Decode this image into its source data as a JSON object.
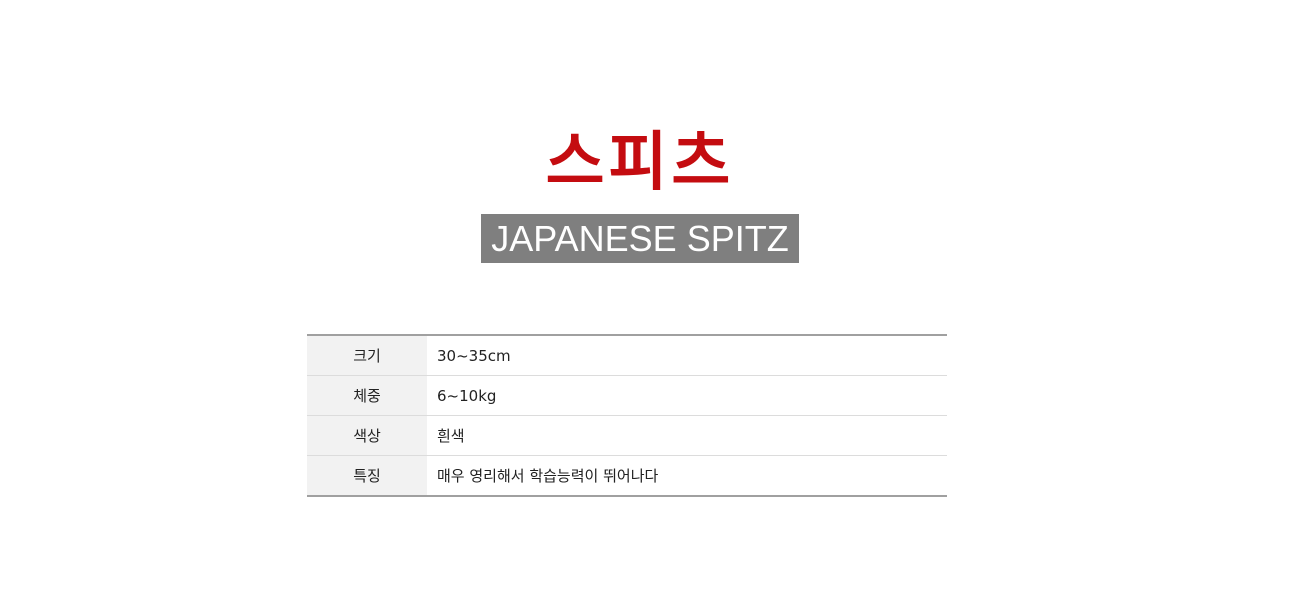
{
  "title": "스피츠",
  "subtitle": "JAPANESE SPITZ",
  "colors": {
    "title": "#c40c10",
    "subtitle_bg": "#7f7f7f",
    "label_bg": "#f2f2f2"
  },
  "specs": [
    {
      "label": "크기",
      "value": "30~35cm"
    },
    {
      "label": "체중",
      "value": "6~10kg"
    },
    {
      "label": "색상",
      "value": "흰색"
    },
    {
      "label": "특징",
      "value": "매우 영리해서 학습능력이 뛰어나다"
    }
  ]
}
